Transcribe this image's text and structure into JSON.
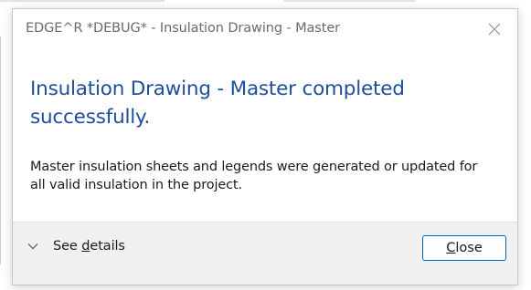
{
  "window": {
    "title": "EDGE^R *DEBUG* - Insulation Drawing - Master"
  },
  "dialog": {
    "heading": "Insulation Drawing - Master completed successfully.",
    "message": "Master insulation sheets and legends were generated or updated for all valid insulation in the project."
  },
  "footer": {
    "details_prefix": "See ",
    "details_access_key": "d",
    "details_rest": "etails",
    "close_access_key": "C",
    "close_rest": "lose"
  },
  "icons": {
    "close": "close-icon",
    "expand": "chevron-down-icon"
  },
  "colors": {
    "heading": "#1f4e9c",
    "button_border": "#0067c0",
    "footer_bg": "#f0f0f0"
  }
}
